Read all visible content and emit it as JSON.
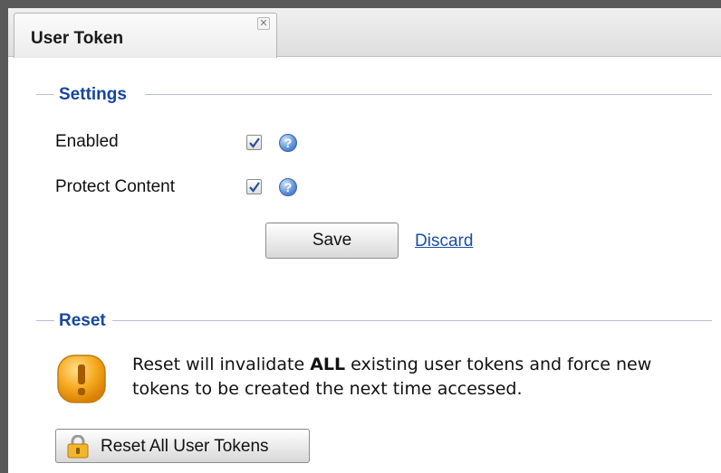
{
  "tab": {
    "label": "User Token",
    "close_glyph": "✕"
  },
  "settings": {
    "legend": "Settings",
    "fields": [
      {
        "label": "Enabled",
        "checked": true,
        "help_glyph": "?"
      },
      {
        "label": "Protect Content",
        "checked": true,
        "help_glyph": "?"
      }
    ],
    "save_label": "Save",
    "discard_label": "Discard"
  },
  "reset": {
    "legend": "Reset",
    "warning_before": "Reset will invalidate ",
    "warning_bold": "ALL",
    "warning_after": " existing user tokens and force new tokens to be created the next time accessed.",
    "button_label": "Reset All User Tokens"
  },
  "colors": {
    "legend": "#17469c",
    "link": "#1a4fa5",
    "warning": "#f0a21a"
  },
  "icons": {
    "close": "close-icon",
    "help": "help-icon",
    "warning": "warning-icon",
    "lock": "lock-icon",
    "check": "check-icon"
  }
}
